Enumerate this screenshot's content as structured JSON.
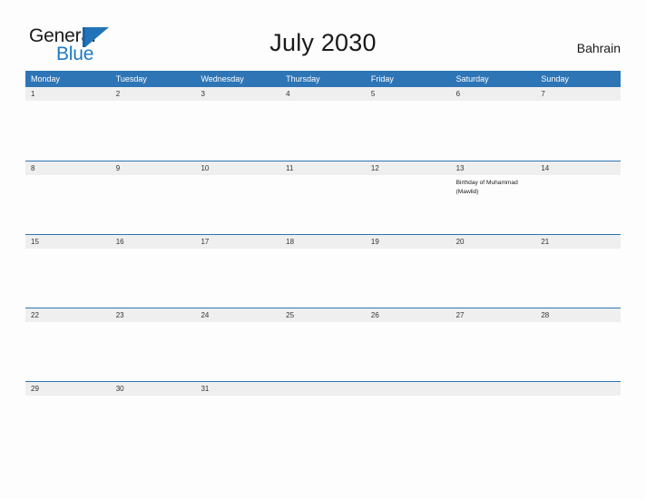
{
  "brand": {
    "name_part1": "General",
    "name_part2": "Blue",
    "mark": "triangle-logo-mark",
    "accent_color": "#2173b8"
  },
  "header": {
    "title": "July 2030",
    "region": "Bahrain"
  },
  "theme": {
    "header_blue": "#2e75b6",
    "date_band_gray": "#efefef",
    "page_background": "#fdfdfd",
    "text_color": "#1a1a1a"
  },
  "calendar": {
    "weekdays": [
      "Monday",
      "Tuesday",
      "Wednesday",
      "Thursday",
      "Friday",
      "Saturday",
      "Sunday"
    ],
    "weeks": [
      {
        "days": [
          {
            "date": "1",
            "event": ""
          },
          {
            "date": "2",
            "event": ""
          },
          {
            "date": "3",
            "event": ""
          },
          {
            "date": "4",
            "event": ""
          },
          {
            "date": "5",
            "event": ""
          },
          {
            "date": "6",
            "event": ""
          },
          {
            "date": "7",
            "event": ""
          }
        ]
      },
      {
        "days": [
          {
            "date": "8",
            "event": ""
          },
          {
            "date": "9",
            "event": ""
          },
          {
            "date": "10",
            "event": ""
          },
          {
            "date": "11",
            "event": ""
          },
          {
            "date": "12",
            "event": ""
          },
          {
            "date": "13",
            "event": "Birthday of Muhammad (Mawlid)"
          },
          {
            "date": "14",
            "event": ""
          }
        ]
      },
      {
        "days": [
          {
            "date": "15",
            "event": ""
          },
          {
            "date": "16",
            "event": ""
          },
          {
            "date": "17",
            "event": ""
          },
          {
            "date": "18",
            "event": ""
          },
          {
            "date": "19",
            "event": ""
          },
          {
            "date": "20",
            "event": ""
          },
          {
            "date": "21",
            "event": ""
          }
        ]
      },
      {
        "days": [
          {
            "date": "22",
            "event": ""
          },
          {
            "date": "23",
            "event": ""
          },
          {
            "date": "24",
            "event": ""
          },
          {
            "date": "25",
            "event": ""
          },
          {
            "date": "26",
            "event": ""
          },
          {
            "date": "27",
            "event": ""
          },
          {
            "date": "28",
            "event": ""
          }
        ]
      },
      {
        "days": [
          {
            "date": "29",
            "event": ""
          },
          {
            "date": "30",
            "event": ""
          },
          {
            "date": "31",
            "event": ""
          },
          {
            "date": "",
            "event": ""
          },
          {
            "date": "",
            "event": ""
          },
          {
            "date": "",
            "event": ""
          },
          {
            "date": "",
            "event": ""
          }
        ]
      }
    ]
  }
}
